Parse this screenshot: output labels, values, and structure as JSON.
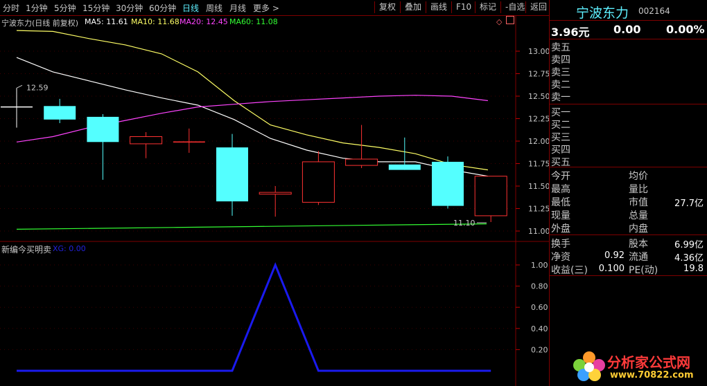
{
  "toolbar": {
    "tabs": [
      "分时",
      "1分钟",
      "5分钟",
      "15分钟",
      "30分钟",
      "60分钟",
      "日线",
      "周线",
      "月线",
      "更多 >"
    ],
    "active_tab": "日线",
    "buttons": [
      "复权",
      "叠加",
      "画线",
      "F10",
      "标记",
      "-自选",
      "返回"
    ]
  },
  "legend": {
    "title": "宁波东力(日线 前复权)",
    "ma5": "MA5: 11.61",
    "ma10": "MA10: 11.68",
    "ma20": "MA20: 12.45",
    "ma60": "MA60: 11.08",
    "colors": {
      "ma5": "#ffffff",
      "ma10": "#ffff66",
      "ma20": "#ff44ff",
      "ma60": "#33ff33"
    }
  },
  "indicator": {
    "title": "新编今买明卖",
    "value": "XG: 0.00"
  },
  "chart_data": [
    {
      "type": "candlestick",
      "ylim": [
        10.95,
        13.2
      ],
      "yticks": [
        "13.00",
        "12.75",
        "12.50",
        "12.25",
        "12.00",
        "11.75",
        "11.50",
        "11.25",
        "11.00"
      ],
      "candles": [
        {
          "open": 12.38,
          "close": 12.38,
          "high": 12.59,
          "low": 12.15
        },
        {
          "open": 12.39,
          "close": 12.24,
          "high": 12.47,
          "low": 12.2
        },
        {
          "open": 12.27,
          "close": 11.99,
          "high": 12.3,
          "low": 11.57
        },
        {
          "open": 11.97,
          "close": 12.05,
          "high": 12.1,
          "low": 11.81
        },
        {
          "open": 11.99,
          "close": 11.99,
          "high": 12.14,
          "low": 11.87
        },
        {
          "open": 11.93,
          "close": 11.33,
          "high": 12.08,
          "low": 11.17
        },
        {
          "open": 11.41,
          "close": 11.43,
          "high": 11.5,
          "low": 11.16
        },
        {
          "open": 11.32,
          "close": 11.77,
          "high": 11.89,
          "low": 11.29
        },
        {
          "open": 11.73,
          "close": 11.8,
          "high": 12.18,
          "low": 11.7
        },
        {
          "open": 11.74,
          "close": 11.68,
          "high": 12.04,
          "low": 11.68
        },
        {
          "open": 11.77,
          "close": 11.28,
          "high": 11.83,
          "low": 11.25
        },
        {
          "open": 11.17,
          "close": 11.61,
          "high": 11.61,
          "low": 11.1
        }
      ],
      "ma5": [
        12.93,
        12.77,
        12.67,
        12.57,
        12.48,
        12.4,
        12.24,
        12.03,
        11.9,
        11.81,
        11.77,
        11.77,
        11.68,
        11.61
      ],
      "ma10": [
        13.23,
        13.22,
        13.14,
        13.07,
        12.97,
        12.77,
        12.45,
        12.18,
        12.07,
        11.98,
        11.93,
        11.86,
        11.74,
        11.68
      ],
      "ma20": [
        11.99,
        12.05,
        12.15,
        12.23,
        12.31,
        12.38,
        12.41,
        12.44,
        12.46,
        12.48,
        12.5,
        12.51,
        12.5,
        12.45
      ],
      "ma60": [
        11.02,
        11.03,
        11.04,
        11.05,
        11.06,
        11.07,
        11.08
      ],
      "annotations": {
        "high_label": "12.59",
        "low_label": "11.10"
      }
    },
    {
      "type": "line",
      "ylim": [
        0,
        1.05
      ],
      "yticks": [
        "1.00",
        "0.80",
        "0.60",
        "0.40",
        "0.20"
      ],
      "values": [
        0,
        0,
        0,
        0,
        0,
        0,
        1,
        0,
        0,
        0,
        0,
        0
      ]
    }
  ],
  "quote": {
    "name": "宁波东力",
    "code": "002164",
    "price": "3.96元",
    "change": "0.00",
    "pct": "0.00%",
    "sell_labels": [
      "卖五",
      "卖四",
      "卖三",
      "卖二",
      "卖一"
    ],
    "buy_labels": [
      "买一",
      "买二",
      "买三",
      "买四",
      "买五"
    ],
    "stats_left": [
      {
        "label": "今开",
        "value": ""
      },
      {
        "label": "最高",
        "value": ""
      },
      {
        "label": "最低",
        "value": ""
      },
      {
        "label": "现量",
        "value": ""
      },
      {
        "label": "外盘",
        "value": ""
      }
    ],
    "stats_right": [
      {
        "label": "均价",
        "value": ""
      },
      {
        "label": "量比",
        "value": ""
      },
      {
        "label": "市值",
        "value": "27.7亿"
      },
      {
        "label": "总量",
        "value": ""
      },
      {
        "label": "内盘",
        "value": ""
      }
    ],
    "fund_left": [
      {
        "label": "换手",
        "value": ""
      },
      {
        "label": "净资",
        "value": "0.92"
      },
      {
        "label": "收益(三)",
        "value": "0.100"
      }
    ],
    "fund_right": [
      {
        "label": "股本",
        "value": "6.99亿"
      },
      {
        "label": "流通",
        "value": "4.36亿"
      },
      {
        "label": "PE(动)",
        "value": "19.8"
      }
    ]
  },
  "watermark": {
    "title": "分析家公式网",
    "url": "www.70822.com"
  }
}
